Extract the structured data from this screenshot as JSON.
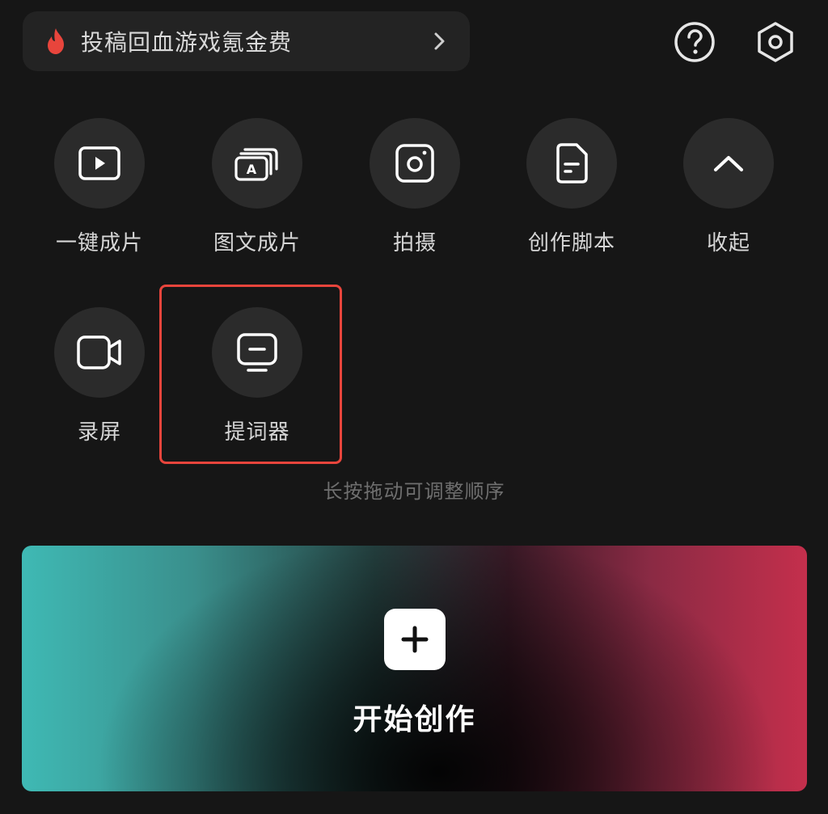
{
  "promo": {
    "text": "投稿回血游戏氪金费",
    "icon": "fire-icon",
    "accent": "#e8453c"
  },
  "header_icons": {
    "help": "help-icon",
    "settings": "gear-icon"
  },
  "tools": [
    {
      "label": "一键成片",
      "icon": "play-icon"
    },
    {
      "label": "图文成片",
      "icon": "text-to-video-icon"
    },
    {
      "label": "拍摄",
      "icon": "camera-icon"
    },
    {
      "label": "创作脚本",
      "icon": "document-icon"
    },
    {
      "label": "收起",
      "icon": "chevron-up-icon"
    },
    {
      "label": "录屏",
      "icon": "video-camera-icon"
    },
    {
      "label": "提词器",
      "icon": "teleprompter-icon"
    }
  ],
  "hint": "长按拖动可调整顺序",
  "start": {
    "label": "开始创作",
    "icon": "plus-icon"
  },
  "colors": {
    "background": "#161616",
    "highlight": "#e8453c"
  }
}
